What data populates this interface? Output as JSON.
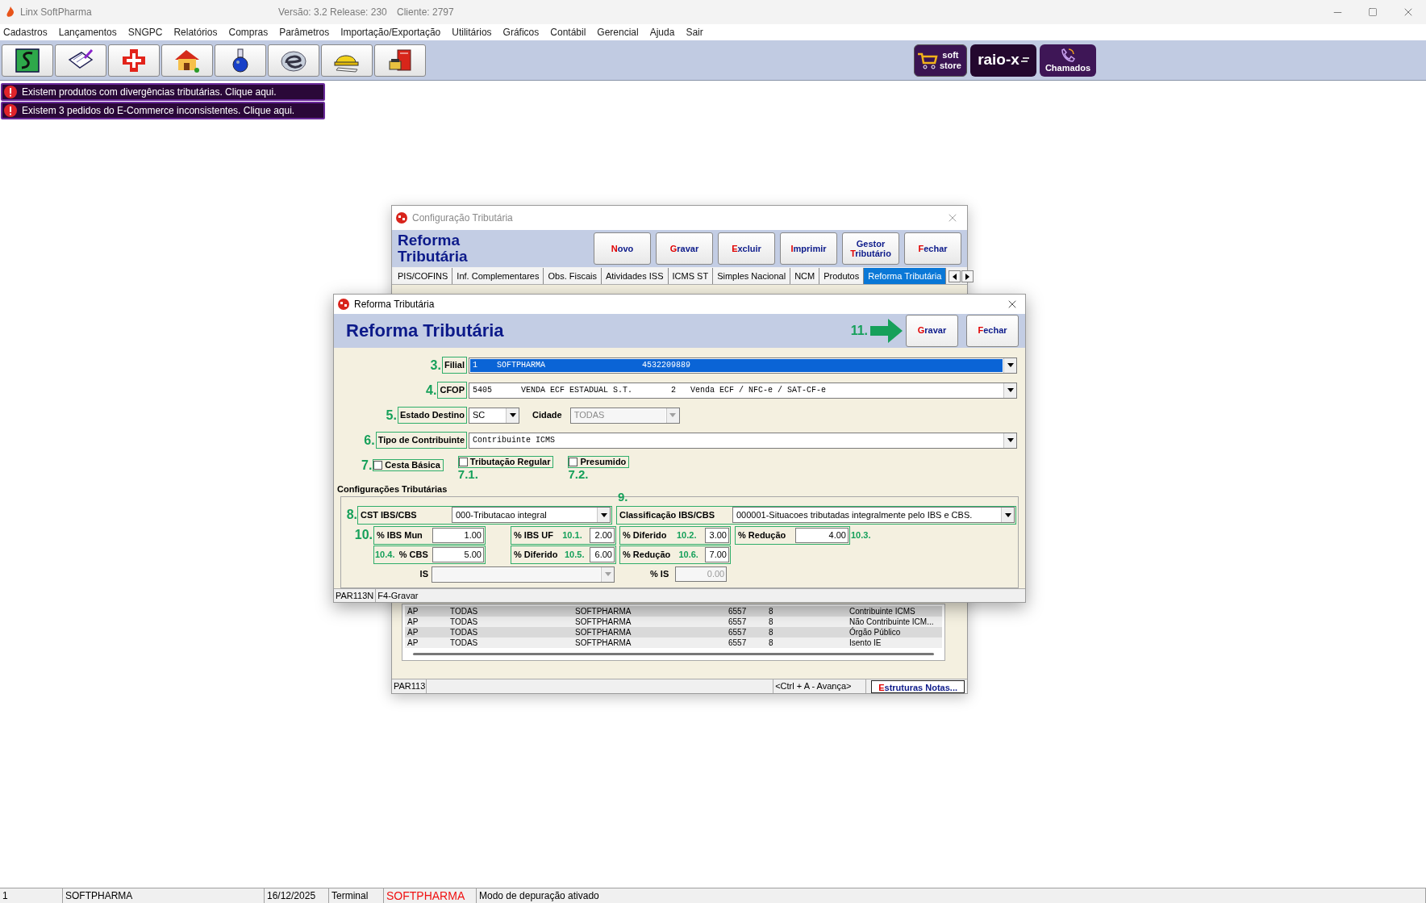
{
  "app": {
    "title": "Linx SoftPharma",
    "version": "Versão: 3.2 Release: 230",
    "client": "Cliente: 2797"
  },
  "menu": [
    "Cadastros",
    "Lançamentos",
    "SNGPC",
    "Relatórios",
    "Compras",
    "Parâmetros",
    "Importação/Exportação",
    "Utilitários",
    "Gráficos",
    "Contábil",
    "Gerencial",
    "Ajuda",
    "Sair"
  ],
  "toolbar": [
    {
      "kind": "sngpc"
    },
    {
      "kind": "notepad"
    },
    {
      "kind": "cross"
    },
    {
      "kind": "house"
    },
    {
      "kind": "flask"
    },
    {
      "kind": "nfe"
    },
    {
      "kind": "helmet"
    },
    {
      "kind": "phonebook"
    }
  ],
  "brand_buttons": [
    {
      "kind": "store",
      "lines": [
        "soft",
        "store"
      ]
    },
    {
      "kind": "xray",
      "lines": [
        "raio-x"
      ]
    },
    {
      "kind": "calls",
      "lines": [
        "Chamados"
      ]
    }
  ],
  "alerts": [
    "Existem produtos com divergências tributárias. Clique aqui.",
    "Existem 3 pedidos do E-Commerce inconsistentes. Clique aqui."
  ],
  "config_window": {
    "title": "Configuração Tributária",
    "heading": "Reforma Tributária",
    "buttons": [
      {
        "key": "N",
        "rest": "ovo"
      },
      {
        "key": "G",
        "rest": "ravar"
      },
      {
        "key": "E",
        "rest": "xcluir"
      },
      {
        "key": "I",
        "rest": "mprimir"
      },
      {
        "pre": "Gestor ",
        "key": "T",
        "rest": "ributário"
      },
      {
        "key": "F",
        "rest": "echar"
      }
    ],
    "tabs": [
      {
        "label": "PIS/COFINS",
        "selected": false
      },
      {
        "label": "Inf. Complementares",
        "selected": false
      },
      {
        "label": "Obs. Fiscais",
        "selected": false
      },
      {
        "label": "Atividades ISS",
        "selected": false
      },
      {
        "label": "ICMS ST",
        "selected": false
      },
      {
        "label": "Simples Nacional",
        "selected": false
      },
      {
        "label": "NCM",
        "selected": false
      },
      {
        "label": "Produtos",
        "selected": false
      },
      {
        "label": "Reforma Tributária",
        "selected": true
      }
    ],
    "rows": [
      [
        "AP",
        "TODAS",
        "SOFTPHARMA",
        "6557",
        "8",
        "Contribuinte ICMS"
      ],
      [
        "AP",
        "TODAS",
        "SOFTPHARMA",
        "6557",
        "8",
        "Não Contribuinte ICM..."
      ],
      [
        "AP",
        "TODAS",
        "SOFTPHARMA",
        "6557",
        "8",
        "Órgão Público"
      ],
      [
        "AP",
        "TODAS",
        "SOFTPHARMA",
        "6557",
        "8",
        "Isento IE"
      ]
    ],
    "status": {
      "code": "PAR113",
      "hint": "<Ctrl + A - Avança>",
      "button": {
        "key": "E",
        "rest": "struturas Notas..."
      }
    }
  },
  "dialog": {
    "title": "Reforma Tributária",
    "heading": "Reforma Tributária",
    "save_step": "11.",
    "buttons": [
      {
        "key": "G",
        "rest": "ravar"
      },
      {
        "key": "F",
        "rest": "echar"
      }
    ],
    "filial": {
      "step": "3.",
      "label": "Filial",
      "value": "1    SOFTPHARMA                    4532209889",
      "highlighted": true
    },
    "cfop": {
      "step": "4.",
      "label": "CFOP",
      "value": "5405      VENDA ECF ESTADUAL S.T.        2   Venda ECF / NFC-e / SAT-CF-e",
      "highlighted": false
    },
    "estado": {
      "step": "5.",
      "label": "Estado Destino",
      "value": "SC",
      "disabled": false
    },
    "cidade": {
      "label": "Cidade",
      "value": "TODAS",
      "disabled": true
    },
    "tipo": {
      "step": "6.",
      "label": "Tipo de Contribuinte",
      "value": "Contribuinte ICMS",
      "highlighted": false
    },
    "options": [
      {
        "step": "7.",
        "label": "Cesta Básica",
        "checked": false,
        "kind": "step_left"
      },
      {
        "step": "7.1.",
        "label": "Tributação Regular",
        "checked": false,
        "kind": "step_below"
      },
      {
        "step": "7.2.",
        "label": "Presumido",
        "checked": false,
        "kind": "step_below"
      }
    ],
    "section": "Configurações Tributárias",
    "cst": {
      "step": "8.",
      "label": "CST IBS/CBS",
      "value": "000-Tributacao integral"
    },
    "classificacao": {
      "step": "9.",
      "label": "Classificação IBS/CBS",
      "value": "000001-Situacoes tributadas integralmente pelo IBS e CBS."
    },
    "ibs_mun": {
      "step": "10.",
      "label": "% IBS Mun",
      "value": "1.00"
    },
    "ibs_uf": {
      "step": "10.1.",
      "label": "% IBS UF",
      "value": "2.00"
    },
    "diferido_1": {
      "step": "10.2.",
      "label": "% Diferido",
      "value": "3.00"
    },
    "reducao_1": {
      "step": "10.3.",
      "label": "% Redução",
      "value": "4.00"
    },
    "cbs": {
      "step": "10.4.",
      "label": "% CBS",
      "value": "5.00"
    },
    "diferido_2": {
      "step": "10.5.",
      "label": "% Diferido",
      "value": "6.00"
    },
    "reducao_2": {
      "step": "10.6.",
      "label": "% Redução",
      "value": "7.00"
    },
    "is": {
      "label": "IS",
      "disabled": true
    },
    "is_rate": {
      "label": "% IS",
      "value": "0.00",
      "disabled": true
    },
    "status": [
      "PAR113N",
      "F4-Gravar"
    ]
  },
  "status_bar": [
    {
      "text": "1",
      "kind": "plain"
    },
    {
      "text": "SOFTPHARMA",
      "kind": "plain"
    },
    {
      "text": "16/12/2025",
      "kind": "plain"
    },
    {
      "text": "Terminal",
      "kind": "plain"
    },
    {
      "text": "SOFTPHARMA",
      "kind": "brand"
    },
    {
      "text": "Modo de depuração ativado",
      "kind": "plain"
    }
  ]
}
